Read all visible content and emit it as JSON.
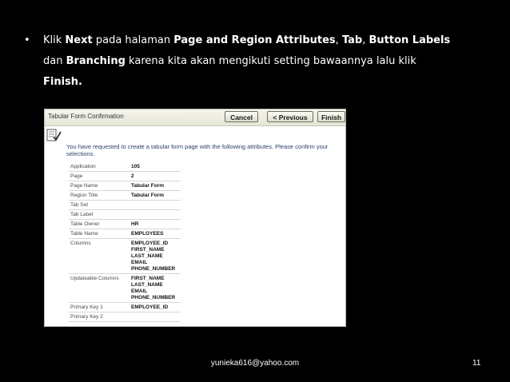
{
  "slide": {
    "bullet": "•",
    "parts": [
      {
        "text": "Klik ",
        "bold": false
      },
      {
        "text": "Next",
        "bold": true
      },
      {
        "text": " pada halaman ",
        "bold": false
      },
      {
        "text": "Page and Region Attributes",
        "bold": true
      },
      {
        "text": ", ",
        "bold": false
      },
      {
        "text": "Tab",
        "bold": true
      },
      {
        "text": ", ",
        "bold": false
      },
      {
        "text": "Button Labels",
        "bold": true
      },
      {
        "text": " dan ",
        "bold": false
      },
      {
        "text": "Branching",
        "bold": true
      },
      {
        "text": " karena kita akan mengikuti setting bawaannya lalu klik ",
        "bold": false
      },
      {
        "text": "Finish.",
        "bold": true
      }
    ],
    "footer_email": "yunieka616@yahoo.com",
    "page_number": "11"
  },
  "screenshot": {
    "region_title": "Tabular Form Confirmation",
    "buttons": {
      "cancel": "Cancel",
      "previous": "< Previous",
      "finish": "Finish"
    },
    "icon": "checklist-icon",
    "message": "You have requested to create a tabular form page with the following attributes. Please confirm your selections.",
    "attributes": [
      {
        "label": "Application",
        "value": "105"
      },
      {
        "label": "Page",
        "value": "2"
      },
      {
        "label": "Page Name",
        "value": "Tabular Form"
      },
      {
        "label": "Region Title",
        "value": "Tabular Form"
      },
      {
        "label": "Tab Set",
        "value": ""
      },
      {
        "label": "Tab Label",
        "value": ""
      },
      {
        "label": "Table Owner",
        "value": "HR"
      },
      {
        "label": "Table Name",
        "value": "EMPLOYEES"
      },
      {
        "label": "Columns",
        "value": "EMPLOYEE_ID\nFIRST_NAME\nLAST_NAME\nEMAIL\nPHONE_NUMBER"
      },
      {
        "label": "Updateable Columns",
        "value": "FIRST_NAME\nLAST_NAME\nEMAIL\nPHONE_NUMBER"
      },
      {
        "label": "Primary Key 1",
        "value": "EMPLOYEE_ID"
      },
      {
        "label": "Primary Key 2",
        "value": ""
      }
    ]
  }
}
